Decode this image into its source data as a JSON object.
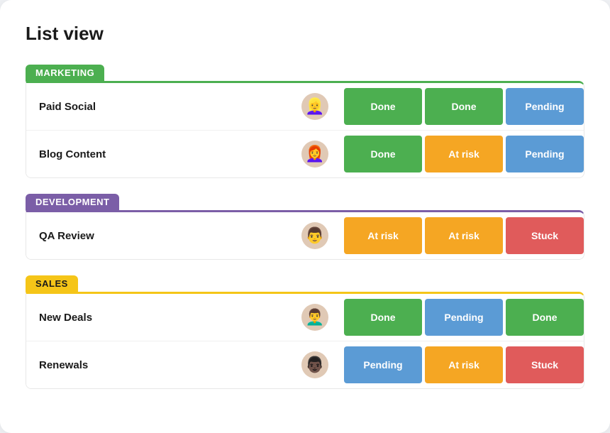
{
  "page": {
    "title": "List view"
  },
  "groups": [
    {
      "id": "marketing",
      "label": "MARKETING",
      "color": "#4caf50",
      "header_text_color": "#fff",
      "rows": [
        {
          "name": "Paid Social",
          "avatar": "👱‍♀️",
          "statuses": [
            {
              "label": "Done",
              "type": "done"
            },
            {
              "label": "Done",
              "type": "done"
            },
            {
              "label": "Pending",
              "type": "pending"
            }
          ]
        },
        {
          "name": "Blog Content",
          "avatar": "👩‍🦰",
          "statuses": [
            {
              "label": "Done",
              "type": "done"
            },
            {
              "label": "At risk",
              "type": "at-risk"
            },
            {
              "label": "Pending",
              "type": "pending"
            }
          ]
        }
      ]
    },
    {
      "id": "development",
      "label": "DEVELOPMENT",
      "color": "#7b5ea7",
      "header_text_color": "#fff",
      "rows": [
        {
          "name": "QA Review",
          "avatar": "👨",
          "statuses": [
            {
              "label": "At risk",
              "type": "at-risk"
            },
            {
              "label": "At risk",
              "type": "at-risk"
            },
            {
              "label": "Stuck",
              "type": "stuck"
            }
          ]
        }
      ]
    },
    {
      "id": "sales",
      "label": "SALES",
      "color": "#f5c518",
      "header_text_color": "#1a1a1a",
      "rows": [
        {
          "name": "New Deals",
          "avatar": "👨‍🦱",
          "statuses": [
            {
              "label": "Done",
              "type": "done"
            },
            {
              "label": "Pending",
              "type": "pending"
            },
            {
              "label": "Done",
              "type": "done"
            }
          ]
        },
        {
          "name": "Renewals",
          "avatar": "👨🏿",
          "statuses": [
            {
              "label": "Pending",
              "type": "pending"
            },
            {
              "label": "At risk",
              "type": "at-risk"
            },
            {
              "label": "Stuck",
              "type": "stuck"
            }
          ]
        }
      ]
    }
  ]
}
